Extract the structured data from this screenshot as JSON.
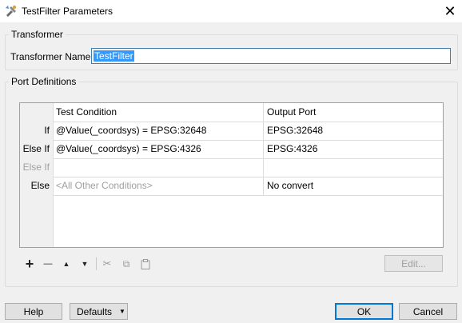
{
  "window": {
    "title": "TestFilter Parameters",
    "close_glyph": "✕"
  },
  "transformer": {
    "group_title": "Transformer",
    "name_label": "Transformer Name:",
    "name_value": "TestFilter"
  },
  "ports": {
    "group_title": "Port Definitions",
    "columns": [
      "Test Condition",
      "Output Port"
    ],
    "rows": [
      {
        "label": "If",
        "condition": "@Value(_coordsys) = EPSG:32648",
        "output": "EPSG:32648",
        "muted": false
      },
      {
        "label": "Else If",
        "condition": "@Value(_coordsys) = EPSG:4326",
        "output": "EPSG:4326",
        "muted": false
      },
      {
        "label": "Else If",
        "condition": "",
        "output": "",
        "muted": true
      },
      {
        "label": "Else",
        "condition": "<All Other Conditions>",
        "output": "No convert",
        "muted": false
      }
    ]
  },
  "toolbar": {
    "add": "+",
    "remove": "—",
    "up": "▲",
    "down": "▼",
    "cut": "✂",
    "copy": "⧉",
    "paste": "📋",
    "edit_label": "Edit..."
  },
  "buttons": {
    "help": "Help",
    "defaults": "Defaults",
    "defaults_arrow": "▼",
    "ok": "OK",
    "cancel": "Cancel"
  },
  "colors": {
    "accent": "#0078d7",
    "selection": "#3399ff",
    "muted_text": "#a0a0a0"
  }
}
